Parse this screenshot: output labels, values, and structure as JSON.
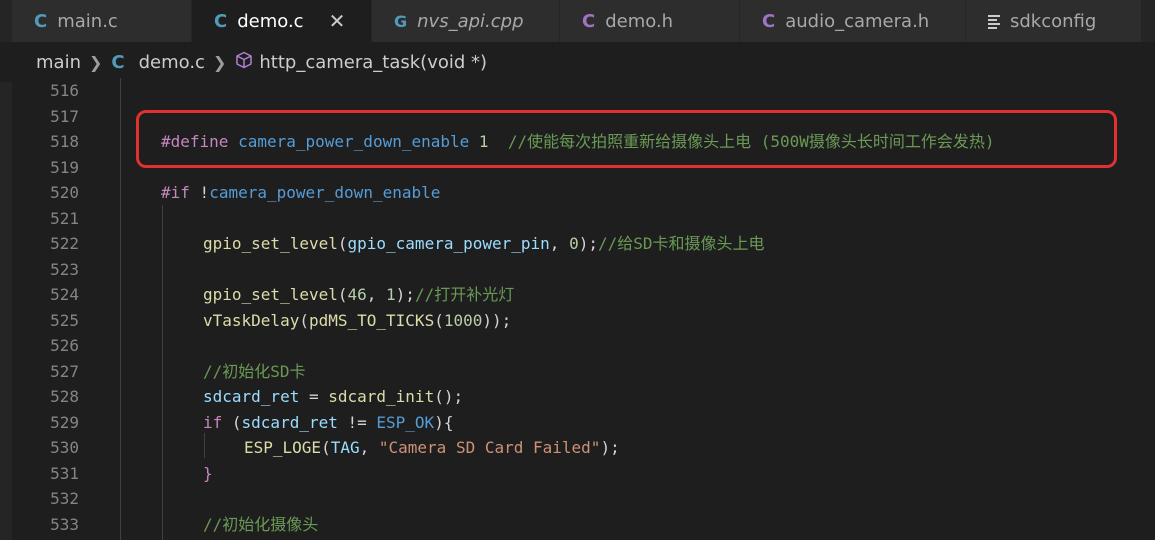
{
  "tabs": [
    {
      "icon": "C",
      "label": "main.c",
      "active": false
    },
    {
      "icon": "C",
      "label": "demo.c",
      "active": true,
      "close": "✕"
    },
    {
      "icon": "G",
      "label": "nvs_api.cpp",
      "active": false
    },
    {
      "icon": "C",
      "label": "demo.h",
      "active": false
    },
    {
      "icon": "C",
      "label": "audio_camera.h",
      "active": false
    },
    {
      "icon": "lines",
      "label": "sdkconfig",
      "active": false
    }
  ],
  "breadcrumb": {
    "folder": "main",
    "file_icon": "C",
    "file": "demo.c",
    "symbol": "http_camera_task(void *)"
  },
  "code": {
    "line_numbers": [
      "516",
      "517",
      "518",
      "519",
      "520",
      "521",
      "522",
      "523",
      "524",
      "525",
      "526",
      "527",
      "528",
      "529",
      "530",
      "531",
      "532",
      "533"
    ],
    "l518": {
      "kw": "#define",
      "name": "camera_power_down_enable",
      "val": "1",
      "comment": "//使能每次拍照重新给摄像头上电 (500W摄像头长时间工作会发热)"
    },
    "l520": {
      "kw": "#if",
      "op": "!",
      "name": "camera_power_down_enable"
    },
    "l522": {
      "fn": "gpio_set_level",
      "p1": "(",
      "arg1": "gpio_camera_power_pin",
      "sep": ", ",
      "arg2": "0",
      "p2": ");",
      "comment": "//给SD卡和摄像头上电"
    },
    "l524": {
      "fn": "gpio_set_level",
      "p1": "(",
      "arg1": "46",
      "sep": ", ",
      "arg2": "1",
      "p2": ");",
      "comment": "//打开补光灯"
    },
    "l525": {
      "fn": "vTaskDelay",
      "p1": "(",
      "fn2": "pdMS_TO_TICKS",
      "p3": "(",
      "arg": "1000",
      "p2": "));"
    },
    "l527": {
      "comment": "//初始化SD卡"
    },
    "l528": {
      "var": "sdcard_ret",
      "eq": " = ",
      "fn": "sdcard_init",
      "p": "();"
    },
    "l529": {
      "kw": "if",
      "p1": " (",
      "var": "sdcard_ret",
      "op": " != ",
      "mac": "ESP_OK",
      "p2": "){"
    },
    "l530": {
      "fn": "ESP_LOGE",
      "p1": "(",
      "var": "TAG",
      "sep": ", ",
      "str": "\"Camera SD Card Failed\"",
      "p2": ");"
    },
    "l531": {
      "brace": "}"
    },
    "l533": {
      "comment": "//初始化摄像头"
    }
  },
  "colors": {
    "highlight_box": "#e03030",
    "editor_bg": "#1e1e1e"
  }
}
